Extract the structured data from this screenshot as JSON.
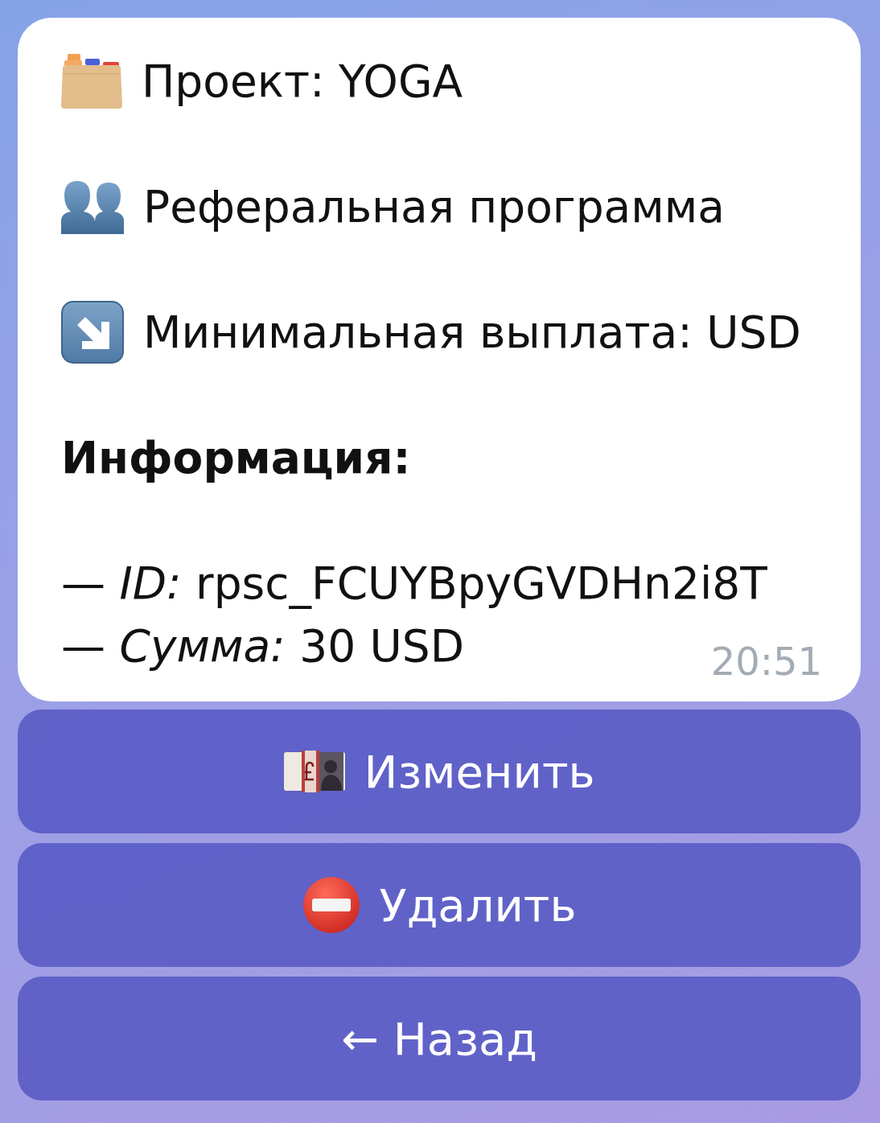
{
  "message": {
    "lines": [
      {
        "kind": "project",
        "text": "Проект: YOGA"
      },
      {
        "kind": "referral",
        "text": "Реферальная программа"
      },
      {
        "kind": "payout",
        "text": "Минимальная выплата: USD"
      }
    ],
    "heading": "Информация:",
    "details": [
      "— *ID:* rpsc_FCUYBpyGVDHn2i8T",
      "— *Сумма:* 30 USD"
    ],
    "time": "20:51"
  },
  "buttons": [
    {
      "kind": "edit",
      "label": "Изменить"
    },
    {
      "kind": "delete",
      "label": "Удалить"
    },
    {
      "kind": "back",
      "label": "← Назад"
    }
  ]
}
